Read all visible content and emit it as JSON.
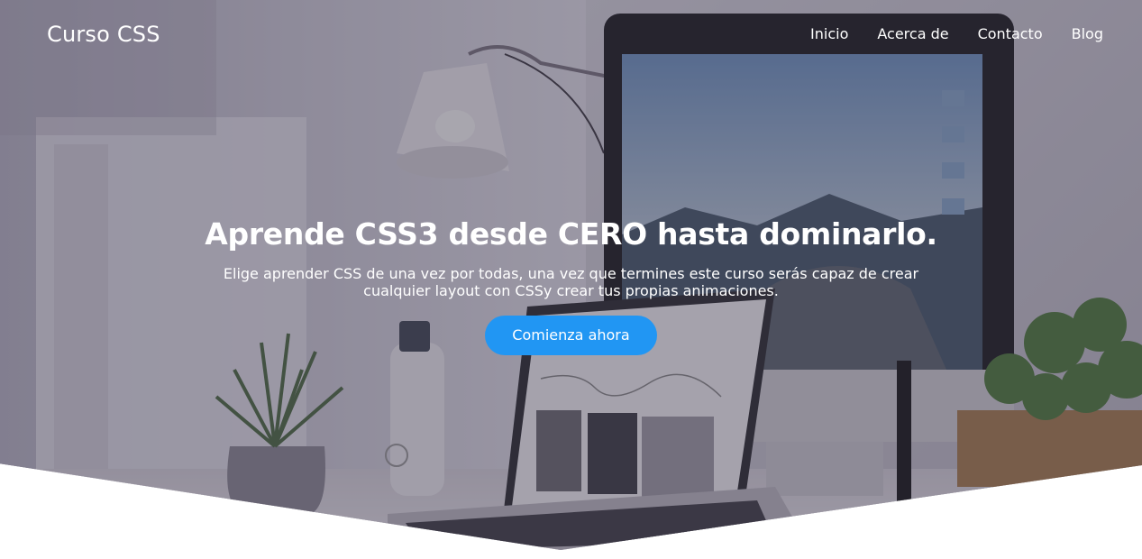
{
  "navbar": {
    "brand": "Curso CSS",
    "links": [
      "Inicio",
      "Acerca de",
      "Contacto",
      "Blog"
    ]
  },
  "hero": {
    "title": "Aprende CSS3 desde CERO hasta dominarlo.",
    "subtitle": "Elige aprender CSS de una vez por todas, una vez que termines este curso serás capaz de crear cualquier layout con CSSy crear tus propias animaciones.",
    "cta_label": "Comienza ahora"
  },
  "colors": {
    "accent": "#2196f3",
    "text": "#ffffff",
    "background": "#ffffff"
  }
}
